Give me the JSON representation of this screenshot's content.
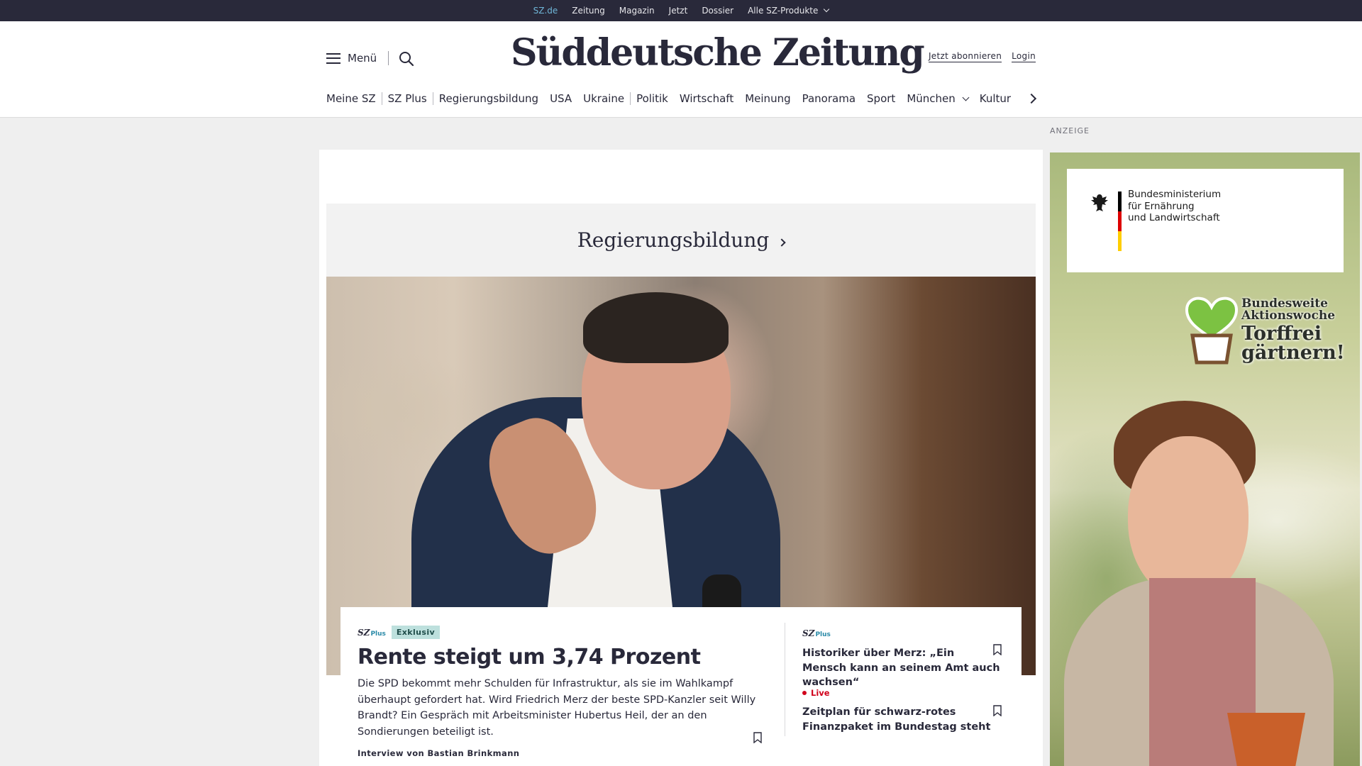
{
  "topbar": {
    "items": [
      "SZ.de",
      "Zeitung",
      "Magazin",
      "Jetzt",
      "Dossier",
      "Alle SZ-Produkte"
    ]
  },
  "header": {
    "menu_label": "Menü",
    "logo": "Süddeutsche Zeitung",
    "subscribe": "Jetzt abonnieren",
    "login": "Login"
  },
  "nav": {
    "items": [
      "Meine SZ",
      "SZ Plus",
      "Regierungsbildung",
      "USA",
      "Ukraine",
      "Politik",
      "Wirtschaft",
      "Meinung",
      "Panorama",
      "Sport",
      "München",
      "Kultur"
    ]
  },
  "topic": {
    "title": "Regierungsbildung"
  },
  "main_teaser": {
    "brand": "SZ",
    "brand_plus": "Plus",
    "badge": "Exklusiv",
    "title": "Rente steigt um 3,74 Prozent",
    "text": "Die SPD bekommt mehr Schulden für Infrastruktur, als sie im Wahlkampf überhaupt gefordert hat. Wird Friedrich Merz der beste SPD-Kanzler seit Willy Brandt? Ein Gespräch mit Arbeitsminister Hubertus Heil, der an den Sondierungen beteiligt ist.",
    "author": "Interview von Bastian Brinkmann"
  },
  "side_teasers": [
    {
      "brand": "SZ",
      "brand_plus": "Plus",
      "title": "Historiker über Merz: „Ein Mensch kann an seinem Amt auch wachsen“"
    },
    {
      "live": "Live",
      "title": "Zeitplan für schwarz-rotes Finanzpaket im Bundestag steht"
    }
  ],
  "ad": {
    "label": "ANZEIGE",
    "ministry_lines": [
      "Bundesministerium",
      "für Ernährung",
      "und Landwirtschaft"
    ],
    "campaign_small": [
      "Bundesweite",
      "Aktionswoche"
    ],
    "campaign_big": [
      "Torffrei",
      "gärtnern!"
    ]
  },
  "colors": {
    "topbar_bg": "#29293a",
    "active_link": "#6fb6d8",
    "badge_bg": "#bde0dd",
    "live_red": "#d0021b",
    "page_bg": "#efefef"
  }
}
